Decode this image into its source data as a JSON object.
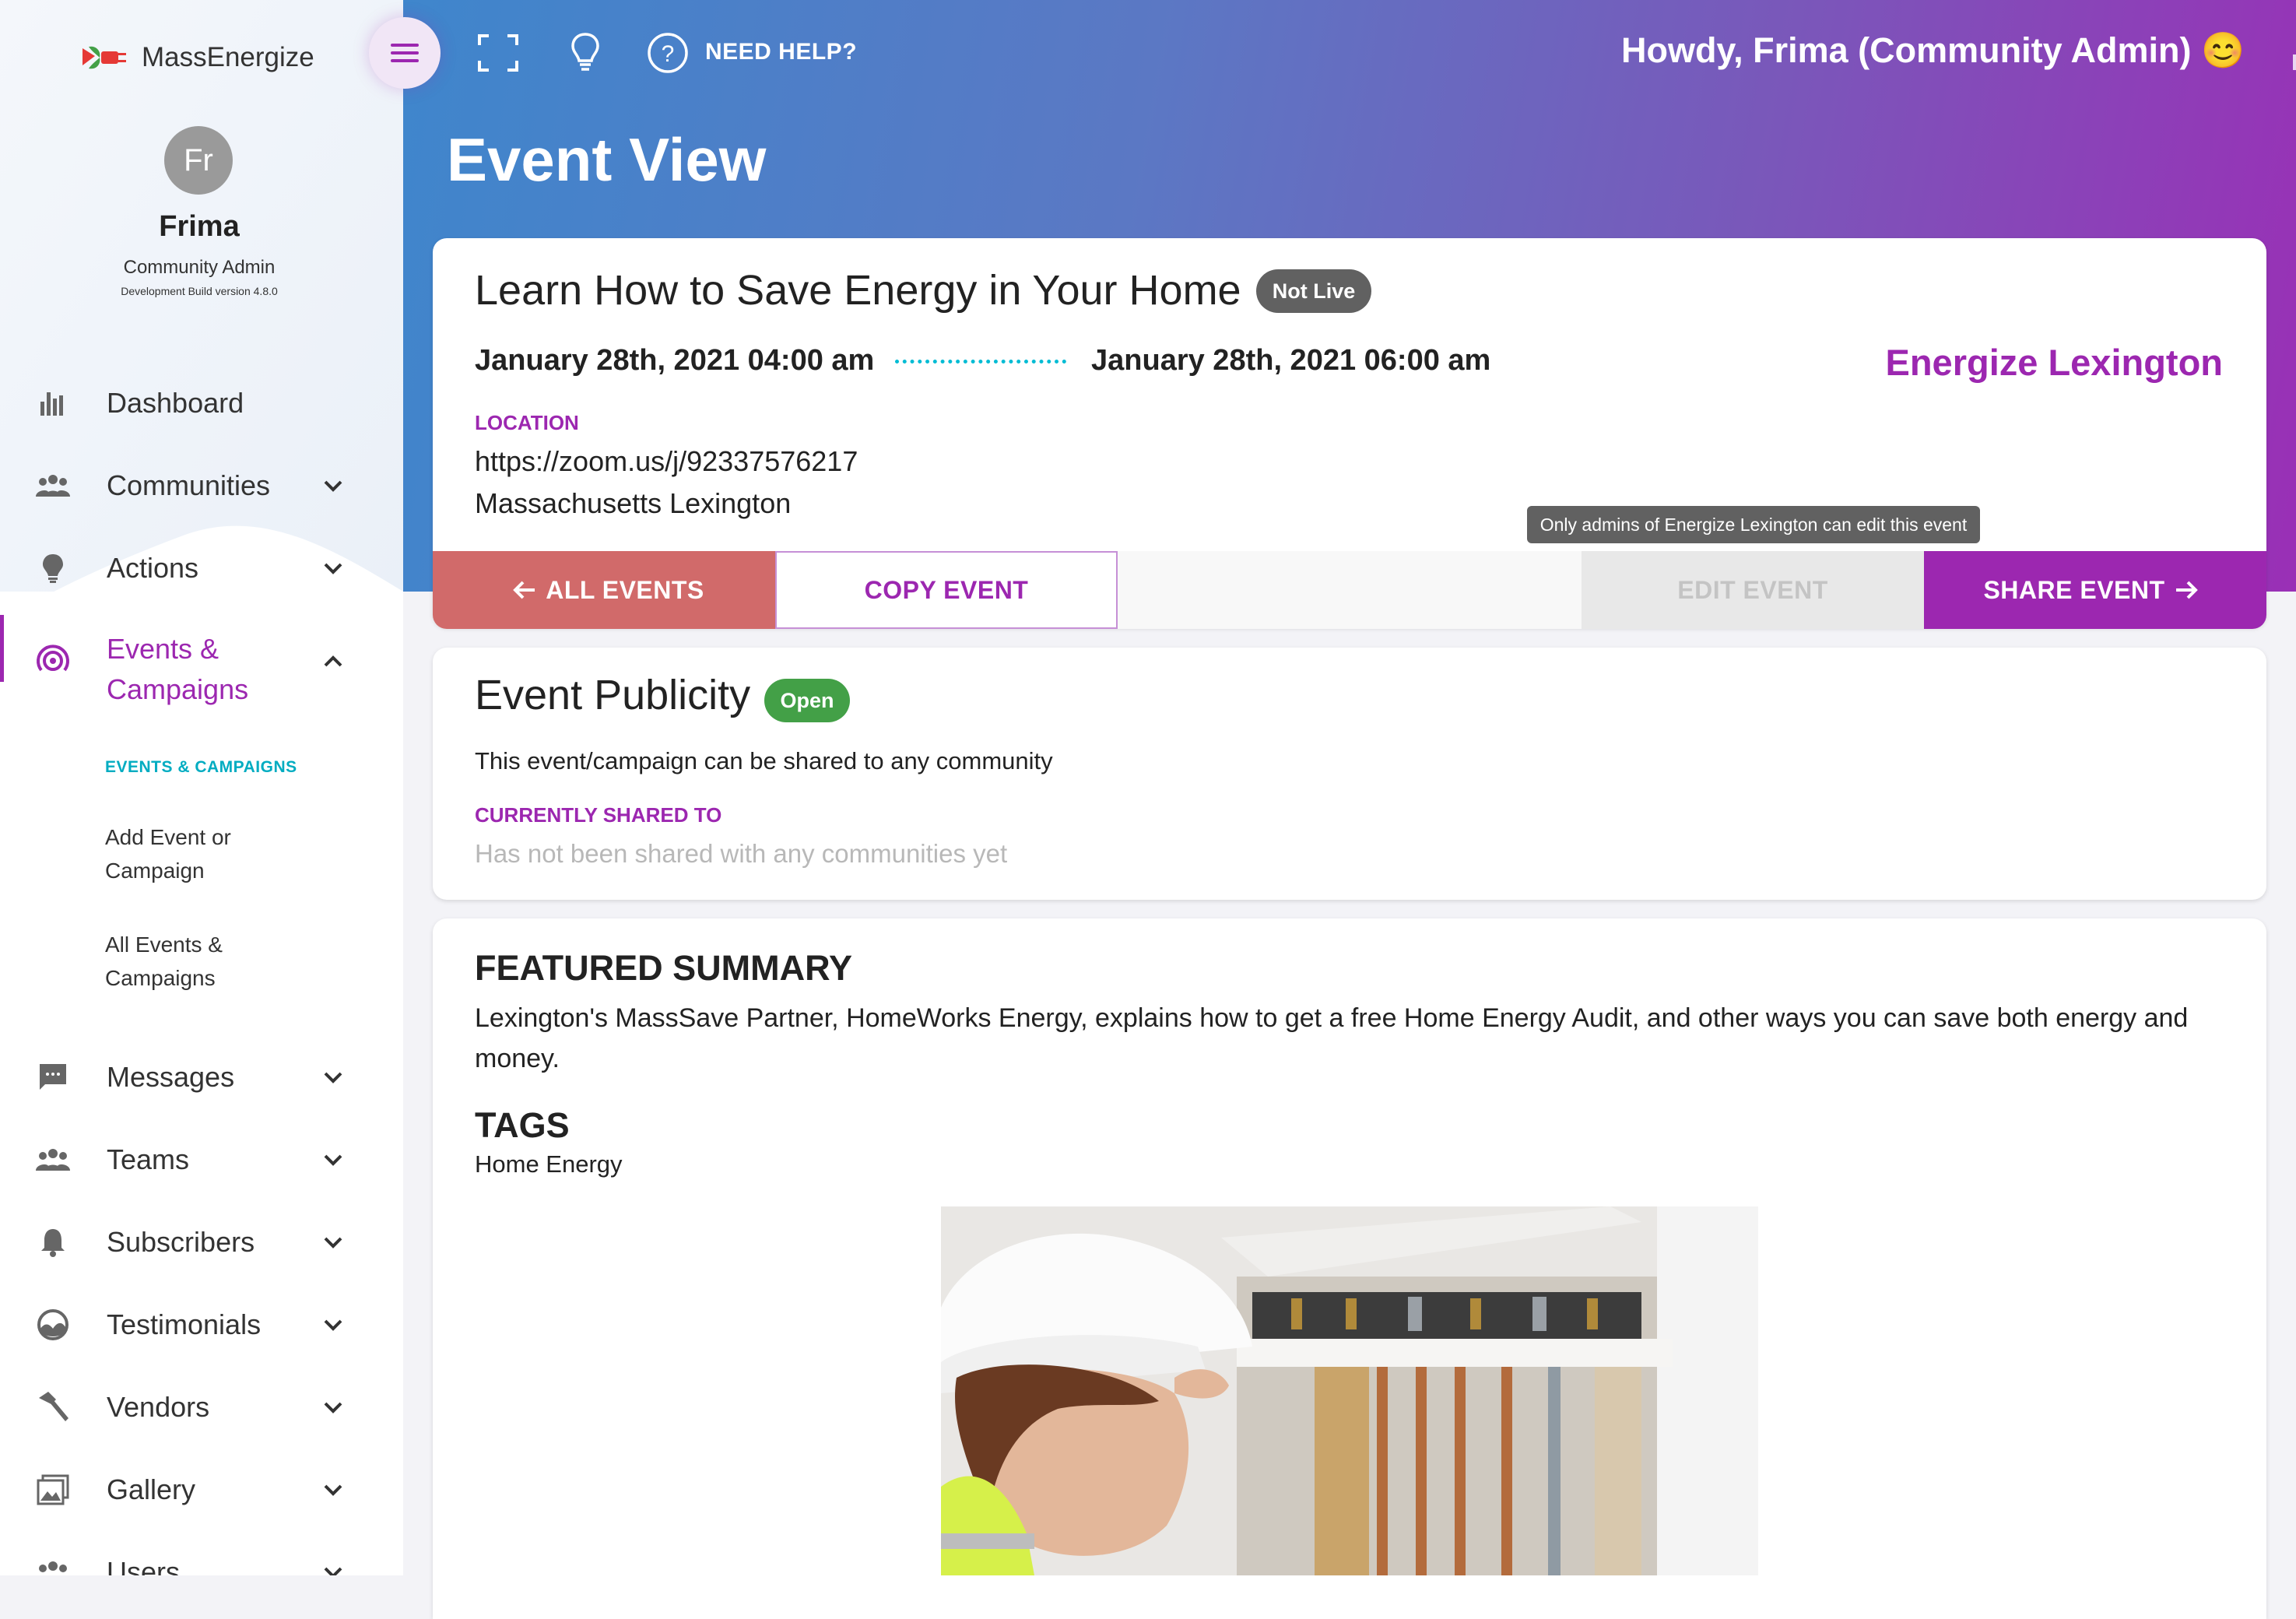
{
  "brand": {
    "name": "MassEnergize"
  },
  "user": {
    "initials": "Fr",
    "name": "Frima",
    "role": "Community Admin",
    "build": "Development Build version 4.8.0"
  },
  "sidebar": {
    "items": [
      {
        "label": "Dashboard",
        "icon": "bar-chart-icon"
      },
      {
        "label": "Communities",
        "icon": "group-icon"
      },
      {
        "label": "Actions",
        "icon": "lightbulb-icon"
      },
      {
        "label": "Events &\nCampaigns",
        "icon": "broadcast-icon"
      },
      {
        "label": "Messages",
        "icon": "chat-icon"
      },
      {
        "label": "Teams",
        "icon": "group-icon"
      },
      {
        "label": "Subscribers",
        "icon": "bell-icon"
      },
      {
        "label": "Testimonials",
        "icon": "testimonial-icon"
      },
      {
        "label": "Vendors",
        "icon": "hammer-icon"
      },
      {
        "label": "Gallery",
        "icon": "gallery-icon"
      },
      {
        "label": "Users",
        "icon": "group-icon"
      }
    ],
    "events_sub": {
      "heading": "EVENTS & CAMPAIGNS",
      "add": "Add Event or Campaign",
      "all": "All Events & Campaigns"
    }
  },
  "header": {
    "help": "NEED HELP?",
    "greeting": "Howdy, Frima (Community Admin) 😊",
    "page_title": "Event View"
  },
  "event": {
    "title": "Learn How to Save Energy in Your Home",
    "status": "Not Live",
    "start": "January 28th, 2021 04:00 am",
    "end": "January 28th, 2021 06:00 am",
    "community": "Energize Lexington",
    "location_label": "LOCATION",
    "location_line1": "https://zoom.us/j/92337576217",
    "location_line2": "Massachusetts Lexington",
    "edit_tooltip": "Only admins of Energize Lexington can edit this event"
  },
  "actions": {
    "all_events": "ALL EVENTS",
    "copy_event": "COPY EVENT",
    "edit_event": "EDIT EVENT",
    "share_event": "SHARE EVENT"
  },
  "publicity": {
    "title": "Event Publicity",
    "status": "Open",
    "description": "This event/campaign can be shared to any community",
    "shared_label": "CURRENTLY SHARED TO",
    "shared_empty": "Has not been shared with any communities yet"
  },
  "summary": {
    "heading": "FEATURED SUMMARY",
    "text": "Lexington's MassSave Partner, HomeWorks Energy, explains how to get a free Home Energy Audit, and other ways you can save both energy and money.",
    "tags_heading": "TAGS",
    "tags": "Home Energy"
  },
  "colors": {
    "accent": "#9c27b0",
    "teal": "#00acc1",
    "all_events_btn": "#d16a6a",
    "not_live": "#616161",
    "open": "#43a047"
  }
}
